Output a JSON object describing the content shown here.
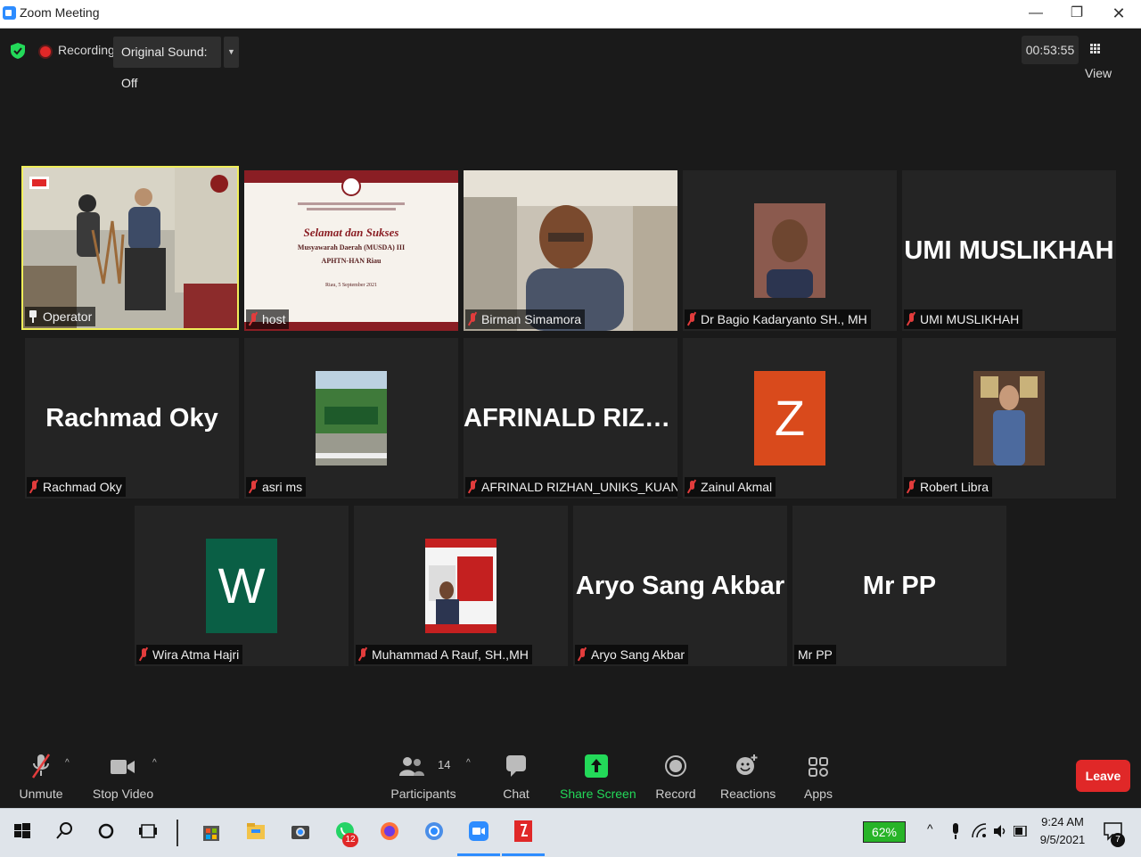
{
  "window": {
    "title": "Zoom Meeting",
    "controls": {
      "minimize": "—",
      "maximize": "❐",
      "close": "✕"
    }
  },
  "top_bar": {
    "recording_label": "Recording",
    "original_sound_label": "Original Sound: Off",
    "timer": "00:53:55",
    "view_label": "View"
  },
  "participants": [
    {
      "name": "Operator",
      "display": "video",
      "muted": false,
      "pinned": true,
      "active_speaker": true
    },
    {
      "name": "host",
      "display": "video",
      "muted": true
    },
    {
      "name": "Birman Simamora",
      "display": "video",
      "muted": true
    },
    {
      "name": "Dr Bagio Kadaryanto SH., MH",
      "display": "photo",
      "muted": true
    },
    {
      "name": "UMI MUSLIKHAH",
      "display": "name",
      "big_name": "UMI MUSLIKHAH",
      "muted": true
    },
    {
      "name": "Rachmad Oky",
      "display": "name",
      "big_name": "Rachmad Oky",
      "muted": true
    },
    {
      "name": "asri ms",
      "display": "photo",
      "muted": true
    },
    {
      "name": "AFRINALD RIZHAN_UNIKS_KUANSING",
      "display": "name",
      "big_name": "AFRINALD  RIZH...",
      "muted": true
    },
    {
      "name": "Zainul Akmal",
      "display": "letter",
      "letter": "Z",
      "letter_bg": "#d94a1c",
      "muted": true
    },
    {
      "name": "Robert Libra",
      "display": "photo",
      "muted": true
    },
    {
      "name": "Wira Atma Hajri",
      "display": "letter",
      "letter": "W",
      "letter_bg": "#0a5f45",
      "muted": true
    },
    {
      "name": "Muhammad A Rauf, SH.,MH",
      "display": "photo",
      "muted": true
    },
    {
      "name": "Aryo Sang Akbar",
      "display": "name",
      "big_name": "Aryo Sang Akbar",
      "muted": true
    },
    {
      "name": "Mr PP",
      "display": "name",
      "big_name": "Mr PP",
      "muted": false
    }
  ],
  "host_slide": {
    "title": "Selamat dan Sukses",
    "line1": "Musyawarah Daerah (MUSDA) III",
    "line2": "APHTN-HAN Riau",
    "date": "Riau, 5 September 2021"
  },
  "toolbar": {
    "unmute": "Unmute",
    "stop_video": "Stop Video",
    "participants": "Participants",
    "participants_count": "14",
    "chat": "Chat",
    "share_screen": "Share Screen",
    "record": "Record",
    "reactions": "Reactions",
    "apps": "Apps",
    "leave": "Leave"
  },
  "taskbar": {
    "battery": "62%",
    "time": "9:24 AM",
    "date": "9/5/2021",
    "whatsapp_badge": "12",
    "notification_count": "7"
  },
  "colors": {
    "accent_green": "#23d959",
    "active_speaker": "#f0ee5a",
    "leave_red": "#e02828",
    "mute_red": "#e23c3c"
  }
}
